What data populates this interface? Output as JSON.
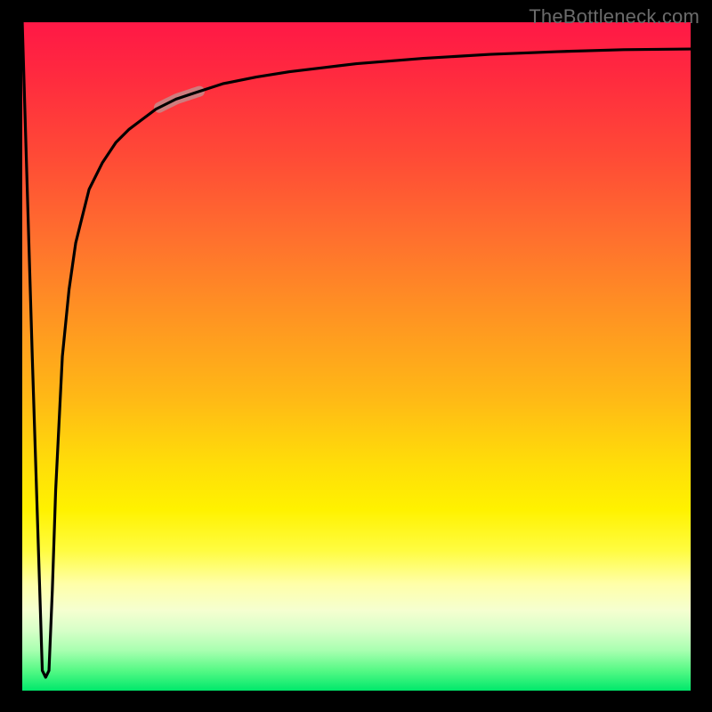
{
  "watermark": "TheBottleneck.com",
  "chart_data": {
    "type": "line",
    "title": "",
    "xlabel": "",
    "ylabel": "",
    "xlim": [
      0,
      100
    ],
    "ylim": [
      0,
      100
    ],
    "grid": false,
    "legend": false,
    "series": [
      {
        "name": "bottleneck-curve",
        "x": [
          0.0,
          1.5,
          3.0,
          3.5,
          4.0,
          4.5,
          5.0,
          6.0,
          7.0,
          8.0,
          10.0,
          12.0,
          14.0,
          16.0,
          18.0,
          20.0,
          23.0,
          26.0,
          30.0,
          35.0,
          40.0,
          45.0,
          50.0,
          55.0,
          60.0,
          70.0,
          80.0,
          90.0,
          100.0
        ],
        "y": [
          100.0,
          50.0,
          3.0,
          2.0,
          3.0,
          15.0,
          30.0,
          50.0,
          60.0,
          67.0,
          75.0,
          79.0,
          82.0,
          84.0,
          85.5,
          87.0,
          88.5,
          89.5,
          90.8,
          91.8,
          92.6,
          93.2,
          93.8,
          94.2,
          94.6,
          95.2,
          95.6,
          95.9,
          96.0
        ]
      }
    ],
    "highlight_segment": {
      "series": "bottleneck-curve",
      "x_start": 20.5,
      "x_end": 26.5,
      "color": "#c58a89",
      "stroke_width": 12
    },
    "background_gradient": {
      "stops": [
        {
          "pos": 0.0,
          "color": "#ff1846"
        },
        {
          "pos": 0.2,
          "color": "#ff4a36"
        },
        {
          "pos": 0.44,
          "color": "#ff9422"
        },
        {
          "pos": 0.66,
          "color": "#ffdd09"
        },
        {
          "pos": 0.84,
          "color": "#ffffa8"
        },
        {
          "pos": 0.94,
          "color": "#a8ffb0"
        },
        {
          "pos": 1.0,
          "color": "#00e86b"
        }
      ]
    }
  }
}
